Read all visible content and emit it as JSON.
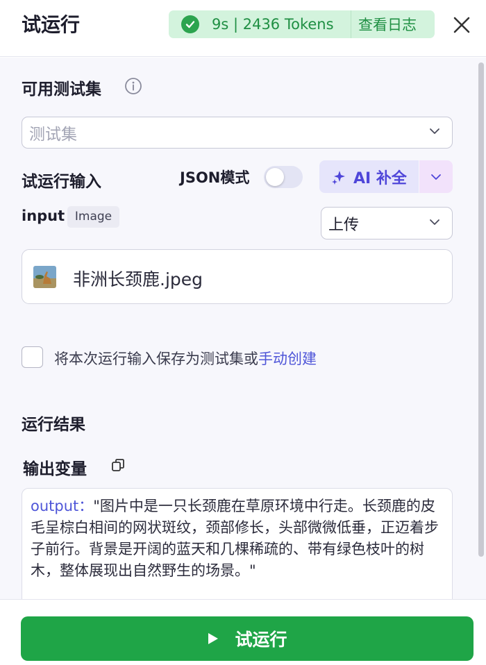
{
  "header": {
    "title": "试运行",
    "metrics": "9s | 2436 Tokens",
    "view_log": "查看日志"
  },
  "testset": {
    "label": "可用测试集",
    "placeholder": "测试集"
  },
  "run_input": {
    "label": "试运行输入",
    "json_mode_label": "JSON模式",
    "json_mode_on": false,
    "ai_complete_label": "AI 补全"
  },
  "input_field": {
    "name": "input",
    "type_tag": "Image",
    "source_select": "上传",
    "file_name": "非洲长颈鹿.jpeg"
  },
  "save_option": {
    "text": "将本次运行输入保存为测试集或",
    "link": "手动创建",
    "checked": false
  },
  "result": {
    "label": "运行结果",
    "output_var_label": "输出变量",
    "output_key": "output：",
    "output_value": "\"图片中是一只长颈鹿在草原环境中行走。长颈鹿的皮毛呈棕白相间的网状斑纹，颈部修长，头部微微低垂，正迈着步子前行。背景是开阔的蓝天和几棵稀疏的、带有绿色枝叶的树木，整体展现出自然野生的场景。\""
  },
  "footer": {
    "run_label": "试运行"
  },
  "colors": {
    "primary_green": "#1fa547",
    "accent_purple": "#4f46d9",
    "link_blue": "#4e55d8"
  }
}
